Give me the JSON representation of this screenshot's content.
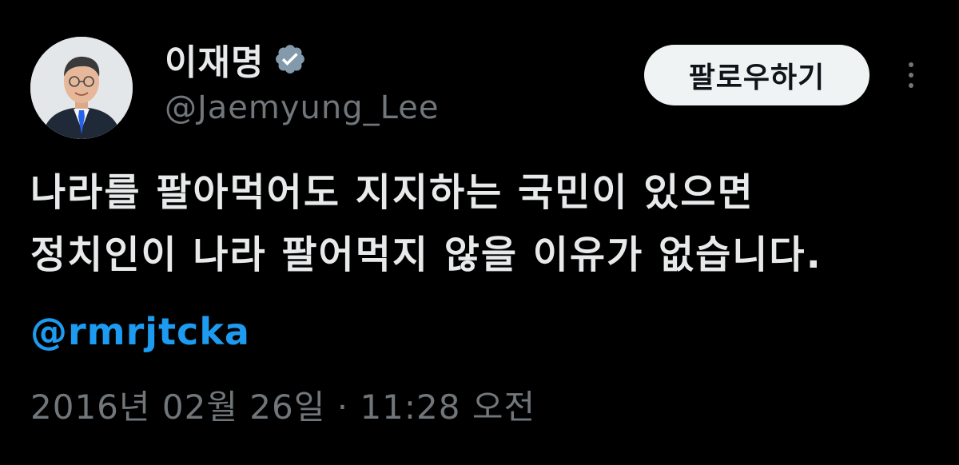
{
  "author": {
    "display_name": "이재명",
    "handle": "@Jaemyung_Lee",
    "verified_icon": "verified-badge-icon",
    "avatar_icon": "profile-photo"
  },
  "actions": {
    "follow_label": "팔로우하기",
    "more_icon": "more-vertical-icon"
  },
  "tweet": {
    "lines": [
      "나라를 팔아먹어도 지지하는 국민이 있으면",
      "정치인이 나라 팔어먹지 않을 이유가 없습니다."
    ],
    "mention": "@rmrjtcka"
  },
  "meta": {
    "timestamp": "2016년 02월 26일 · 11:28 오전"
  },
  "colors": {
    "background": "#000000",
    "text": "#e7e9ea",
    "secondary": "#71767b",
    "link": "#1d9bf0",
    "verified": "#829aab",
    "button_bg": "#eff3f4"
  }
}
